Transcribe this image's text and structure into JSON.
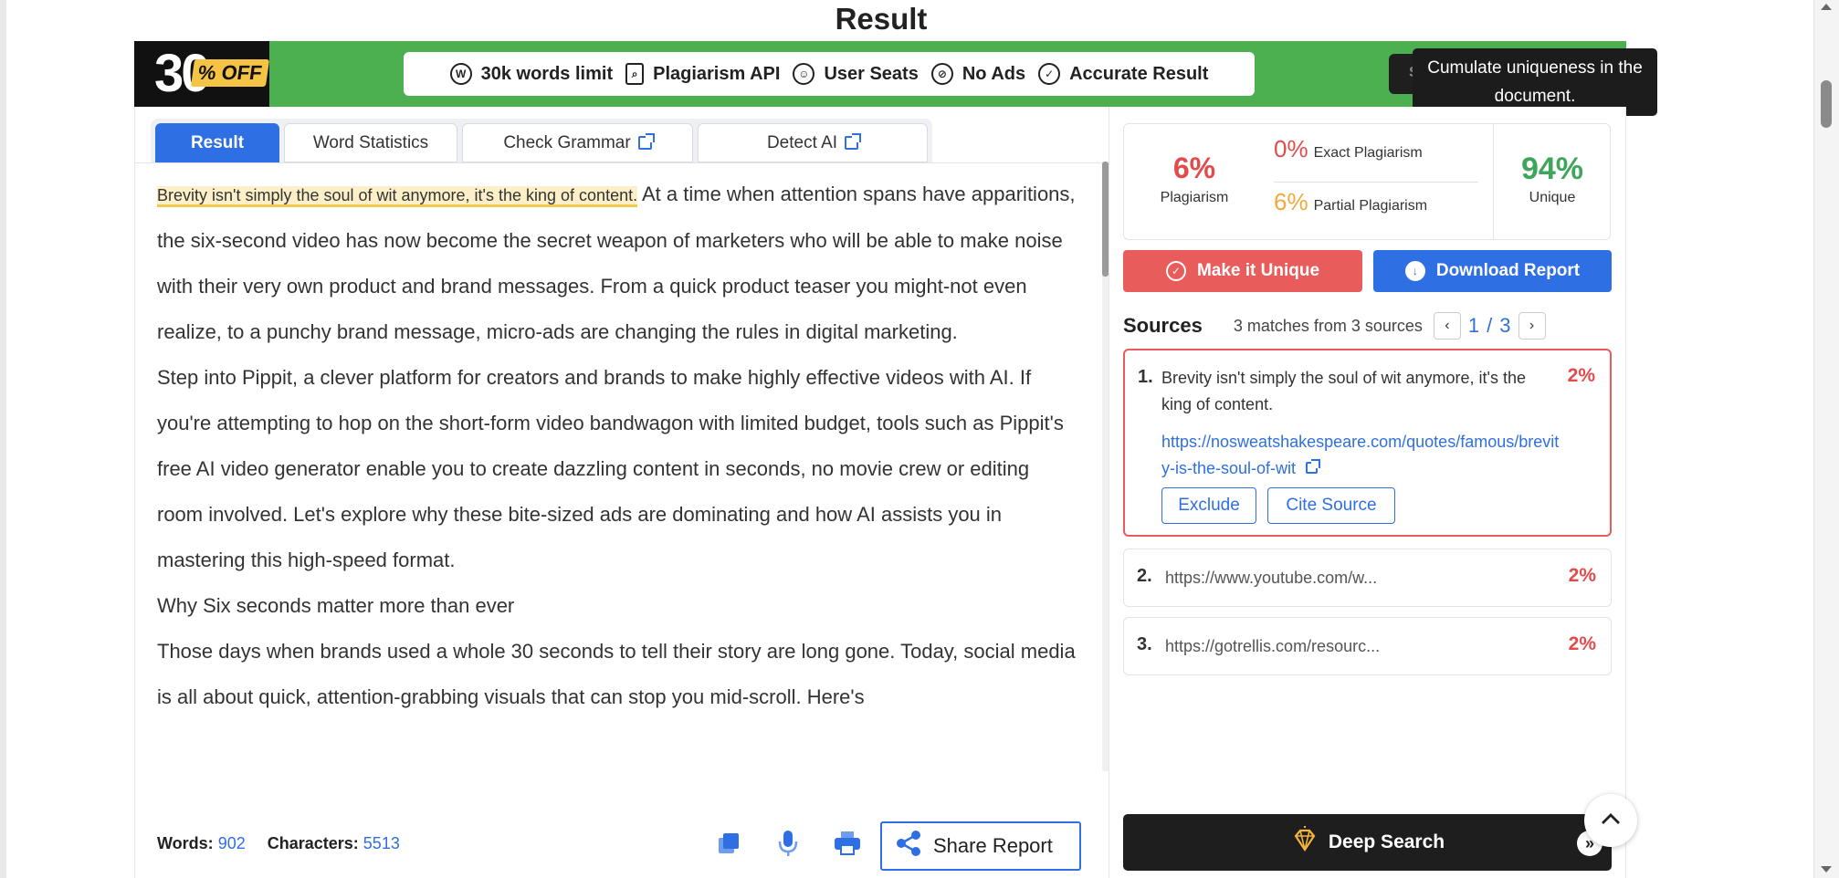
{
  "page": {
    "title": "Result"
  },
  "colors": {
    "brand_green": "#4caf50",
    "primary_blue": "#2f6fe4",
    "danger_red": "#e95c5c",
    "unique_green": "#3ea55b",
    "partial_orange": "#f2a93b",
    "highlight": "#fdf0c8"
  },
  "promo": {
    "discount_number": "30",
    "discount_suffix": "% OFF",
    "features": [
      {
        "icon": "w-circle-icon",
        "label": "30k words limit"
      },
      {
        "icon": "document-search-icon",
        "label": "Plagiarism API"
      },
      {
        "icon": "user-circle-icon",
        "label": "User Seats"
      },
      {
        "icon": "no-ads-icon",
        "label": "No Ads"
      },
      {
        "icon": "check-circle-icon",
        "label": "Accurate Result"
      }
    ],
    "button_label": "Starting..."
  },
  "tooltip": {
    "text": "Cumulate uniqueness in the document."
  },
  "editor": {
    "tabs": [
      {
        "label": "Result",
        "active": true
      },
      {
        "label": "Word Statistics",
        "active": false
      },
      {
        "label": "Check Grammar",
        "active": false,
        "external": true
      },
      {
        "label": "Detect AI",
        "active": false,
        "external": true
      }
    ],
    "highlighted_sentence": "Brevity isn't simply the soul of wit anymore, it's the king of content.",
    "paragraph1_rest": " At a time when attention spans have apparitions, the six-second video has now become the secret weapon of marketers who will be able to make noise with their very own product and brand messages. From a quick product teaser you might-not even realize, to a punchy brand message, micro-ads are changing the rules in digital marketing.",
    "paragraph2": "Step into Pippit, a clever platform for creators and brands to make highly effective videos with AI. If you're attempting to hop on the short-form video bandwagon with limited budget, tools such as Pippit's free AI video generator enable you to create dazzling content in seconds, no movie crew or editing room involved. Let's explore why these bite-sized ads are dominating and how AI assists you in mastering this high-speed format.",
    "paragraph3": "Why Six seconds matter more than ever",
    "paragraph4": "Those days when brands used a whole 30 seconds to tell their story are long gone. Today, social media is all about quick, attention-grabbing visuals that can stop you mid-scroll. Here's",
    "words_label": "Words:",
    "words_value": "902",
    "characters_label": "Characters:",
    "characters_value": "5513",
    "share_label": "Share Report"
  },
  "summary": {
    "plagiarism_pct": "6%",
    "plagiarism_label": "Plagiarism",
    "exact_pct": "0%",
    "exact_label": "Exact Plagiarism",
    "partial_pct": "6%",
    "partial_label": "Partial Plagiarism",
    "unique_pct": "94%",
    "unique_label": "Unique"
  },
  "actions": {
    "make_unique": "Make it Unique",
    "download": "Download Report"
  },
  "sources": {
    "title": "Sources",
    "count_text": "3 matches from 3 sources",
    "page_current": "1",
    "page_sep": "/",
    "page_total": "3",
    "items": [
      {
        "number": "1.",
        "percent": "2%",
        "text": "Brevity isn't simply the soul of wit anymore, it's the king of content.",
        "url": "https://nosweatshakespeare.com/quotes/famous/brevity-is-the-soul-of-wit",
        "exclude": "Exclude",
        "cite": "Cite Source"
      },
      {
        "number": "2.",
        "percent": "2%",
        "url": "https://www.youtube.com/w..."
      },
      {
        "number": "3.",
        "percent": "2%",
        "url": "https://gotrellis.com/resourc..."
      }
    ],
    "deep_search": "Deep Search"
  }
}
